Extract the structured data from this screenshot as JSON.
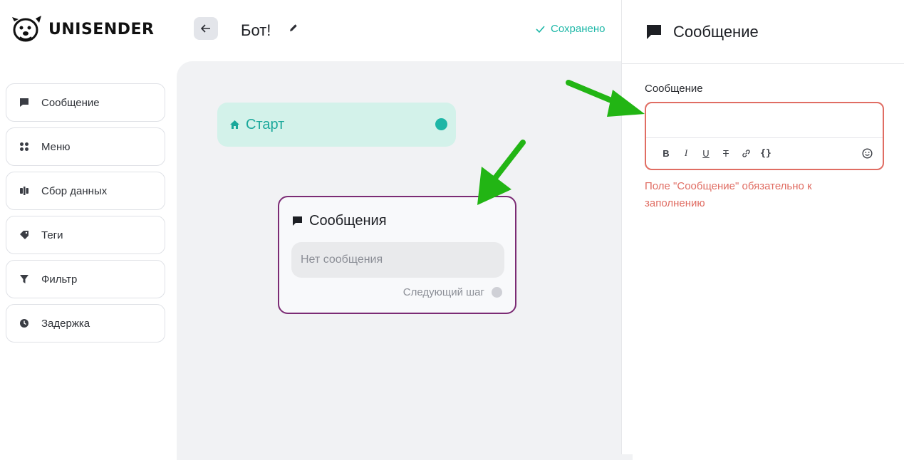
{
  "header": {
    "logo_text": "UNISENDER",
    "bot_title": "Бот!",
    "saved_label": "Сохранено"
  },
  "sidebar": {
    "items": [
      {
        "label": "Сообщение",
        "icon": "message-icon"
      },
      {
        "label": "Меню",
        "icon": "menu-grid-icon"
      },
      {
        "label": "Сбор данных",
        "icon": "data-collection-icon"
      },
      {
        "label": "Теги",
        "icon": "tag-icon"
      },
      {
        "label": "Фильтр",
        "icon": "filter-icon"
      },
      {
        "label": "Задержка",
        "icon": "clock-icon"
      }
    ]
  },
  "canvas": {
    "start_node": {
      "label": "Старт"
    },
    "message_node": {
      "title": "Сообщения",
      "placeholder": "Нет сообщения",
      "next_step": "Следующий шаг"
    }
  },
  "panel": {
    "title": "Сообщение",
    "field_label": "Сообщение",
    "toolbar": [
      "B",
      "I",
      "U",
      "T",
      "link",
      "{}",
      "emoji"
    ],
    "error": "Поле \"Сообщение\" обязательно к заполнению"
  },
  "colors": {
    "accent": "#1db6a6",
    "error": "#e06d63",
    "node_border": "#7b2b74",
    "arrow": "#22b514"
  }
}
